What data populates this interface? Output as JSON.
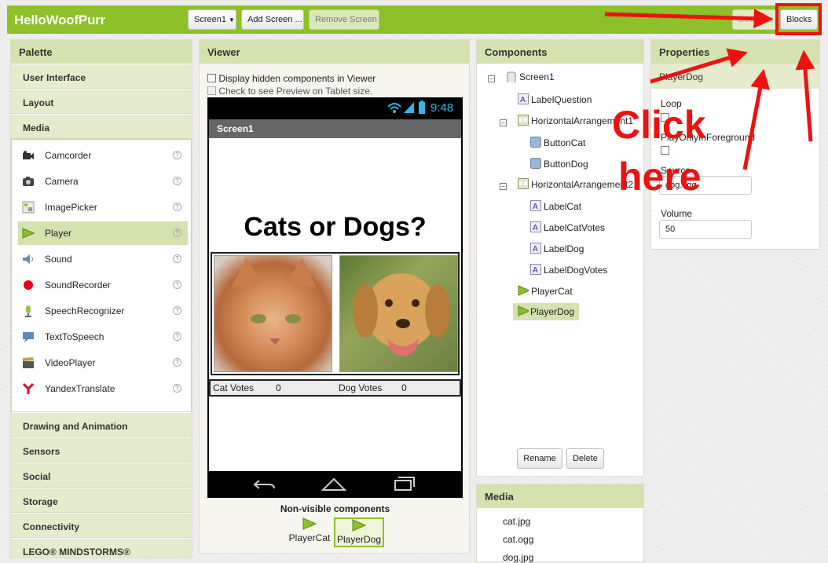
{
  "header": {
    "app_title": "HelloWoofPurr",
    "screen_select": "Screen1",
    "add_screen": "Add Screen ...",
    "remove_screen": "Remove Screen",
    "designer": "Designer",
    "blocks": "Blocks"
  },
  "palette": {
    "title": "Palette",
    "categories_top": [
      "User Interface",
      "Layout",
      "Media"
    ],
    "media_items": [
      {
        "label": "Camcorder",
        "icon": "camcorder-icon"
      },
      {
        "label": "Camera",
        "icon": "camera-icon"
      },
      {
        "label": "ImagePicker",
        "icon": "image-picker-icon"
      },
      {
        "label": "Player",
        "icon": "play-icon"
      },
      {
        "label": "Sound",
        "icon": "speaker-icon"
      },
      {
        "label": "SoundRecorder",
        "icon": "record-icon"
      },
      {
        "label": "SpeechRecognizer",
        "icon": "microphone-icon"
      },
      {
        "label": "TextToSpeech",
        "icon": "speech-bubble-icon"
      },
      {
        "label": "VideoPlayer",
        "icon": "clapperboard-icon"
      },
      {
        "label": "YandexTranslate",
        "icon": "yandex-icon"
      }
    ],
    "help_glyph": "?",
    "categories_bottom": [
      "Drawing and Animation",
      "Sensors",
      "Social",
      "Storage",
      "Connectivity",
      "LEGO® MINDSTORMS®"
    ]
  },
  "viewer": {
    "title": "Viewer",
    "checkbox_hidden": "Display hidden components in Viewer",
    "checkbox_tablet": "Check to see Preview on Tablet size.",
    "clock": "9:48",
    "screen_title": "Screen1",
    "question": "Cats or Dogs?",
    "cat_votes_label": "Cat Votes",
    "cat_votes_value": "0",
    "dog_votes_label": "Dog Votes",
    "dog_votes_value": "0",
    "nonvisible_title": "Non-visible components",
    "nonvisible": [
      "PlayerCat",
      "PlayerDog"
    ]
  },
  "components": {
    "title": "Components",
    "tree": [
      {
        "label": "Screen1"
      },
      {
        "label": "LabelQuestion"
      },
      {
        "label": "HorizontalArrangement1"
      },
      {
        "label": "ButtonCat"
      },
      {
        "label": "ButtonDog"
      },
      {
        "label": "HorizontalArrangement2"
      },
      {
        "label": "LabelCat"
      },
      {
        "label": "LabelCatVotes"
      },
      {
        "label": "LabelDog"
      },
      {
        "label": "LabelDogVotes"
      },
      {
        "label": "PlayerCat"
      },
      {
        "label": "PlayerDog"
      }
    ],
    "collapse_glyph": "−",
    "rename": "Rename",
    "delete": "Delete"
  },
  "media": {
    "title": "Media",
    "files": [
      "cat.jpg",
      "cat.ogg",
      "dog.jpg"
    ]
  },
  "properties": {
    "title": "Properties",
    "component": "PlayerDog",
    "loop_label": "Loop",
    "play_only_label": "PlayOnlyInForeground",
    "source_label": "Source",
    "source_value": "dog.ogg",
    "volume_label": "Volume",
    "volume_value": "50"
  },
  "annotation": {
    "line1": "Click",
    "line2": "here",
    "color": "#ee1111"
  }
}
